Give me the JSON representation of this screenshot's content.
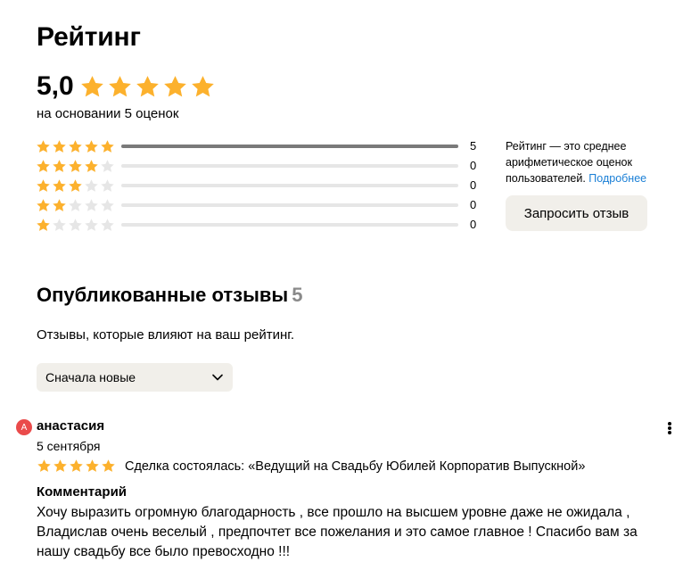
{
  "page": {
    "title": "Рейтинг"
  },
  "rating": {
    "score": "5,0",
    "stars": 5,
    "caption": "на основании 5 оценок",
    "distribution": [
      {
        "stars": 5,
        "count": "5",
        "fraction": 1.0
      },
      {
        "stars": 4,
        "count": "0",
        "fraction": 0
      },
      {
        "stars": 3,
        "count": "0",
        "fraction": 0
      },
      {
        "stars": 2,
        "count": "0",
        "fraction": 0
      },
      {
        "stars": 1,
        "count": "0",
        "fraction": 0
      }
    ],
    "info_text": "Рейтинг — это среднее арифметическое оценок пользователей.",
    "info_link": "Подробнее",
    "request_button": "Запросить отзыв"
  },
  "reviews_section": {
    "title": "Опубликованные отзывы",
    "count": "5",
    "subtitle": "Отзывы, которые влияют на ваш рейтинг.",
    "sort": {
      "selected": "Сначала новые"
    }
  },
  "reviews": [
    {
      "avatar_letter": "А",
      "author": "анастасия",
      "date": "5 сентября",
      "stars": 5,
      "deal": "Сделка состоялась: «Ведущий на Свадьбу Юбилей Корпоратив Выпускной»",
      "comment_title": "Комментарий",
      "comment": "Хочу выразить огромную благодарность , все прошло на высшем уровне даже не ожидала , Владислав очень веселый , предпочтет все пожелания и это самое главное ! Спасибо вам за нашу свадьбу все было превосходно !!!"
    }
  ],
  "colors": {
    "star_filled": "#fcb12d",
    "star_empty": "#e6e6e6",
    "link": "#1a7fd6",
    "avatar": "#ea4b4b",
    "button_bg": "#f1efea"
  }
}
